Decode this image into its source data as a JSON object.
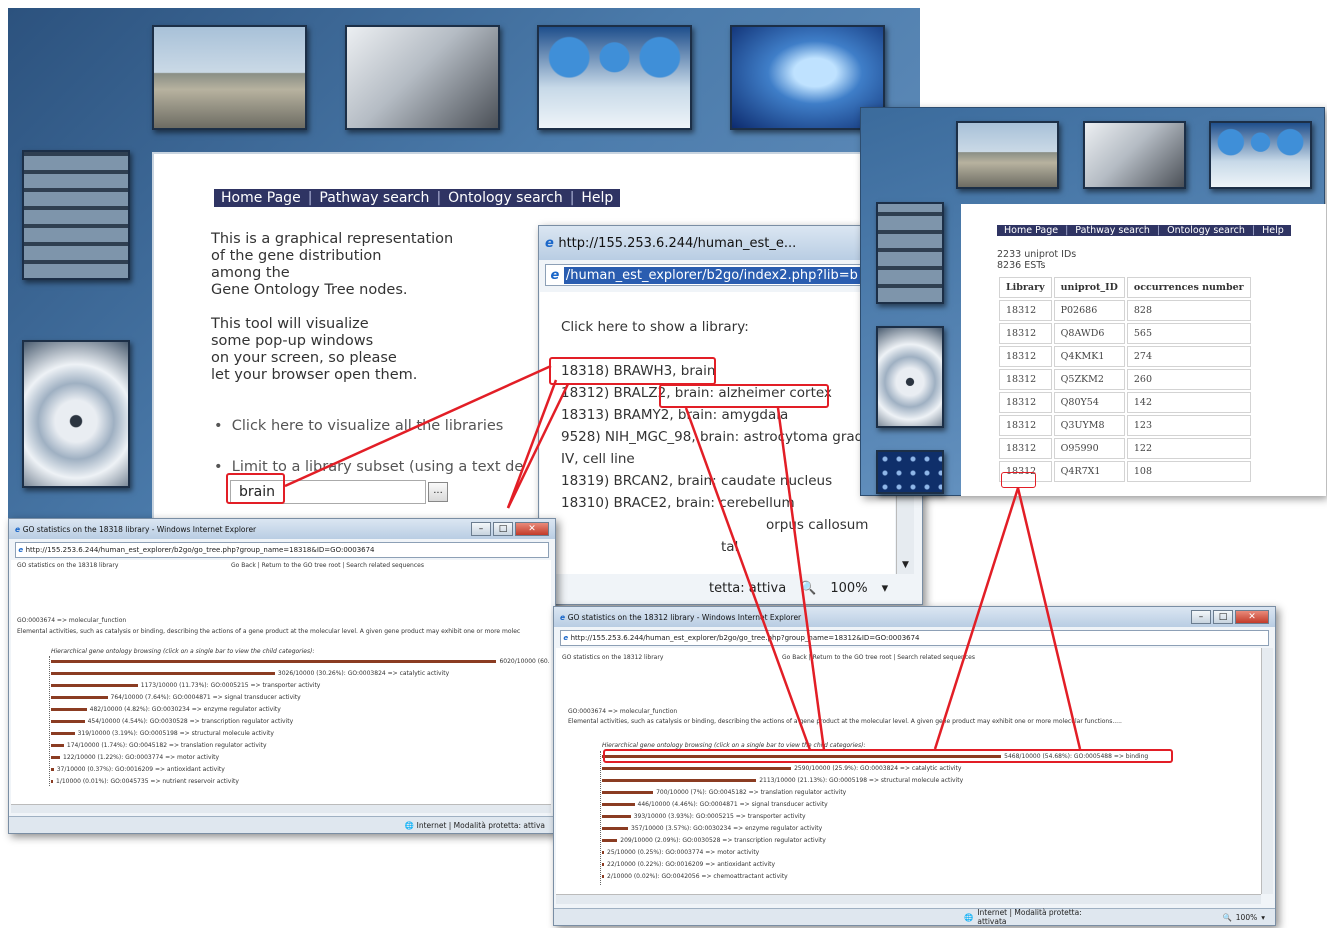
{
  "main_site": {
    "nav": [
      "Home Page",
      "Pathway search",
      "Ontology search",
      "Help"
    ],
    "intro": [
      "This is a graphical representation",
      "of the gene distribution",
      "among the",
      "Gene Ontology Tree nodes."
    ],
    "popup_note": [
      "This tool will visualize",
      "some pop-up windows",
      "on your screen, so please",
      "let your browser open them."
    ],
    "link_all": "Click here to visualize all the libraries",
    "link_subset": "Limit to a library subset (using a text de",
    "search_value": "brain",
    "search_button": "..."
  },
  "library_popup": {
    "title": "http://155.253.6.244/human_est_e...",
    "address": "/human_est_explorer/b2go/index2.php?lib=b",
    "heading": "Click here to show a library:",
    "items": [
      "18318) BRAWH3, brain",
      "18312) BRALZ2, brain: alzheimer cortex",
      "18313) BRAMY2, brain: amygdala",
      "9528) NIH_MGC_98, brain: astrocytoma grade",
      "IV, cell line",
      "18319) BRCAN2, brain: caudate nucleus",
      "18310) BRACE2, brain: cerebellum",
      "orpus callosum",
      "tal"
    ],
    "status": "tetta: attiva",
    "zoom": "100%"
  },
  "uniprot_window": {
    "nav": [
      "Home Page",
      "Pathway search",
      "Ontology search",
      "Help"
    ],
    "summary": [
      "2233 uniprot IDs",
      "8236 ESTs"
    ],
    "columns": [
      "Library",
      "uniprot_ID",
      "occurrences number"
    ],
    "rows": [
      [
        "18312",
        "P02686",
        "828"
      ],
      [
        "18312",
        "Q8AWD6",
        "565"
      ],
      [
        "18312",
        "Q4KMK1",
        "274"
      ],
      [
        "18312",
        "Q5ZKM2",
        "260"
      ],
      [
        "18312",
        "Q80Y54",
        "142"
      ],
      [
        "18312",
        "Q3UYM8",
        "123"
      ],
      [
        "18312",
        "O95990",
        "122"
      ],
      [
        "18312",
        "Q4R7X1",
        "108"
      ]
    ]
  },
  "go_window_1": {
    "title": "GO statistics on the 18318 library - Windows Internet Explorer",
    "address": "http://155.253.6.244/human_est_explorer/b2go/go_tree.php?group_name=18318&ID=GO:0003674",
    "page_label": "GO statistics on the 18318 library",
    "toplinks": "Go Back | Return to the GO tree root | Search related sequences",
    "root": "GO:0003674 => molecular_function",
    "description": "Elemental activities, such as catalysis or binding, describing the actions of a gene product at the molecular level. A given gene product may exhibit one or more molec",
    "browse_label": "Hierarchical gene ontology browsing (click on a single bar to view the child categories):",
    "rows": [
      {
        "label": "6020/10000 (60.",
        "value": 6020
      },
      {
        "label": "3026/10000 (30.26%): GO:0003824 => catalytic activity",
        "value": 3026
      },
      {
        "label": "1173/10000 (11.73%): GO:0005215 => transporter activity",
        "value": 1173
      },
      {
        "label": "764/10000 (7.64%): GO:0004871 => signal transducer activity",
        "value": 764
      },
      {
        "label": "482/10000 (4.82%): GO:0030234 => enzyme regulator activity",
        "value": 482
      },
      {
        "label": "454/10000 (4.54%): GO:0030528 => transcription regulator activity",
        "value": 454
      },
      {
        "label": "319/10000 (3.19%): GO:0005198 => structural molecule activity",
        "value": 319
      },
      {
        "label": "174/10000 (1.74%): GO:0045182 => translation regulator activity",
        "value": 174
      },
      {
        "label": "122/10000 (1.22%): GO:0003774 => motor activity",
        "value": 122
      },
      {
        "label": "37/10000 (0.37%): GO:0016209 => antioxidant activity",
        "value": 37
      },
      {
        "label": "1/10000 (0.01%): GO:0045735 => nutrient reservoir activity",
        "value": 1
      }
    ],
    "status": "Internet | Modalità protetta: attiva"
  },
  "go_window_2": {
    "title": "GO statistics on the 18312 library - Windows Internet Explorer",
    "address": "http://155.253.6.244/human_est_explorer/b2go/go_tree.php?group_name=18312&ID=GO:0003674",
    "page_label": "GO statistics on the 18312 library",
    "toplinks": "Go Back | Return to the GO tree root | Search related sequences",
    "root": "GO:0003674 => molecular_function",
    "description": "Elemental activities, such as catalysis or binding, describing the actions of a gene product at the molecular level. A given gene product may exhibit one or more molecular functions.....",
    "browse_label": "Hierarchical gene ontology browsing (click on a single bar to view the child categories):",
    "rows": [
      {
        "label": "5468/10000 (54.68%): GO:0005488 => binding",
        "value": 5468
      },
      {
        "label": "2590/10000 (25.9%): GO:0003824 => catalytic activity",
        "value": 2590
      },
      {
        "label": "2113/10000 (21.13%): GO:0005198 => structural molecule activity",
        "value": 2113
      },
      {
        "label": "700/10000 (7%): GO:0045182 => translation regulator activity",
        "value": 700
      },
      {
        "label": "446/10000 (4.46%): GO:0004871 => signal transducer activity",
        "value": 446
      },
      {
        "label": "393/10000 (3.93%): GO:0005215 => transporter activity",
        "value": 393
      },
      {
        "label": "357/10000 (3.57%): GO:0030234 => enzyme regulator activity",
        "value": 357
      },
      {
        "label": "209/10000 (2.09%): GO:0030528 => transcription regulator activity",
        "value": 209
      },
      {
        "label": "25/10000 (0.25%): GO:0003774 => motor activity",
        "value": 25
      },
      {
        "label": "22/10000 (0.22%): GO:0016209 => antioxidant activity",
        "value": 22
      },
      {
        "label": "2/10000 (0.02%): GO:0042056 => chemoattractant activity",
        "value": 2
      }
    ],
    "status": "Internet | Modalità protetta: attivata",
    "zoom": "100%"
  },
  "colors": {
    "highlight": "#e21e26",
    "bar": "#8b3c22",
    "nav": "#2f3463"
  }
}
